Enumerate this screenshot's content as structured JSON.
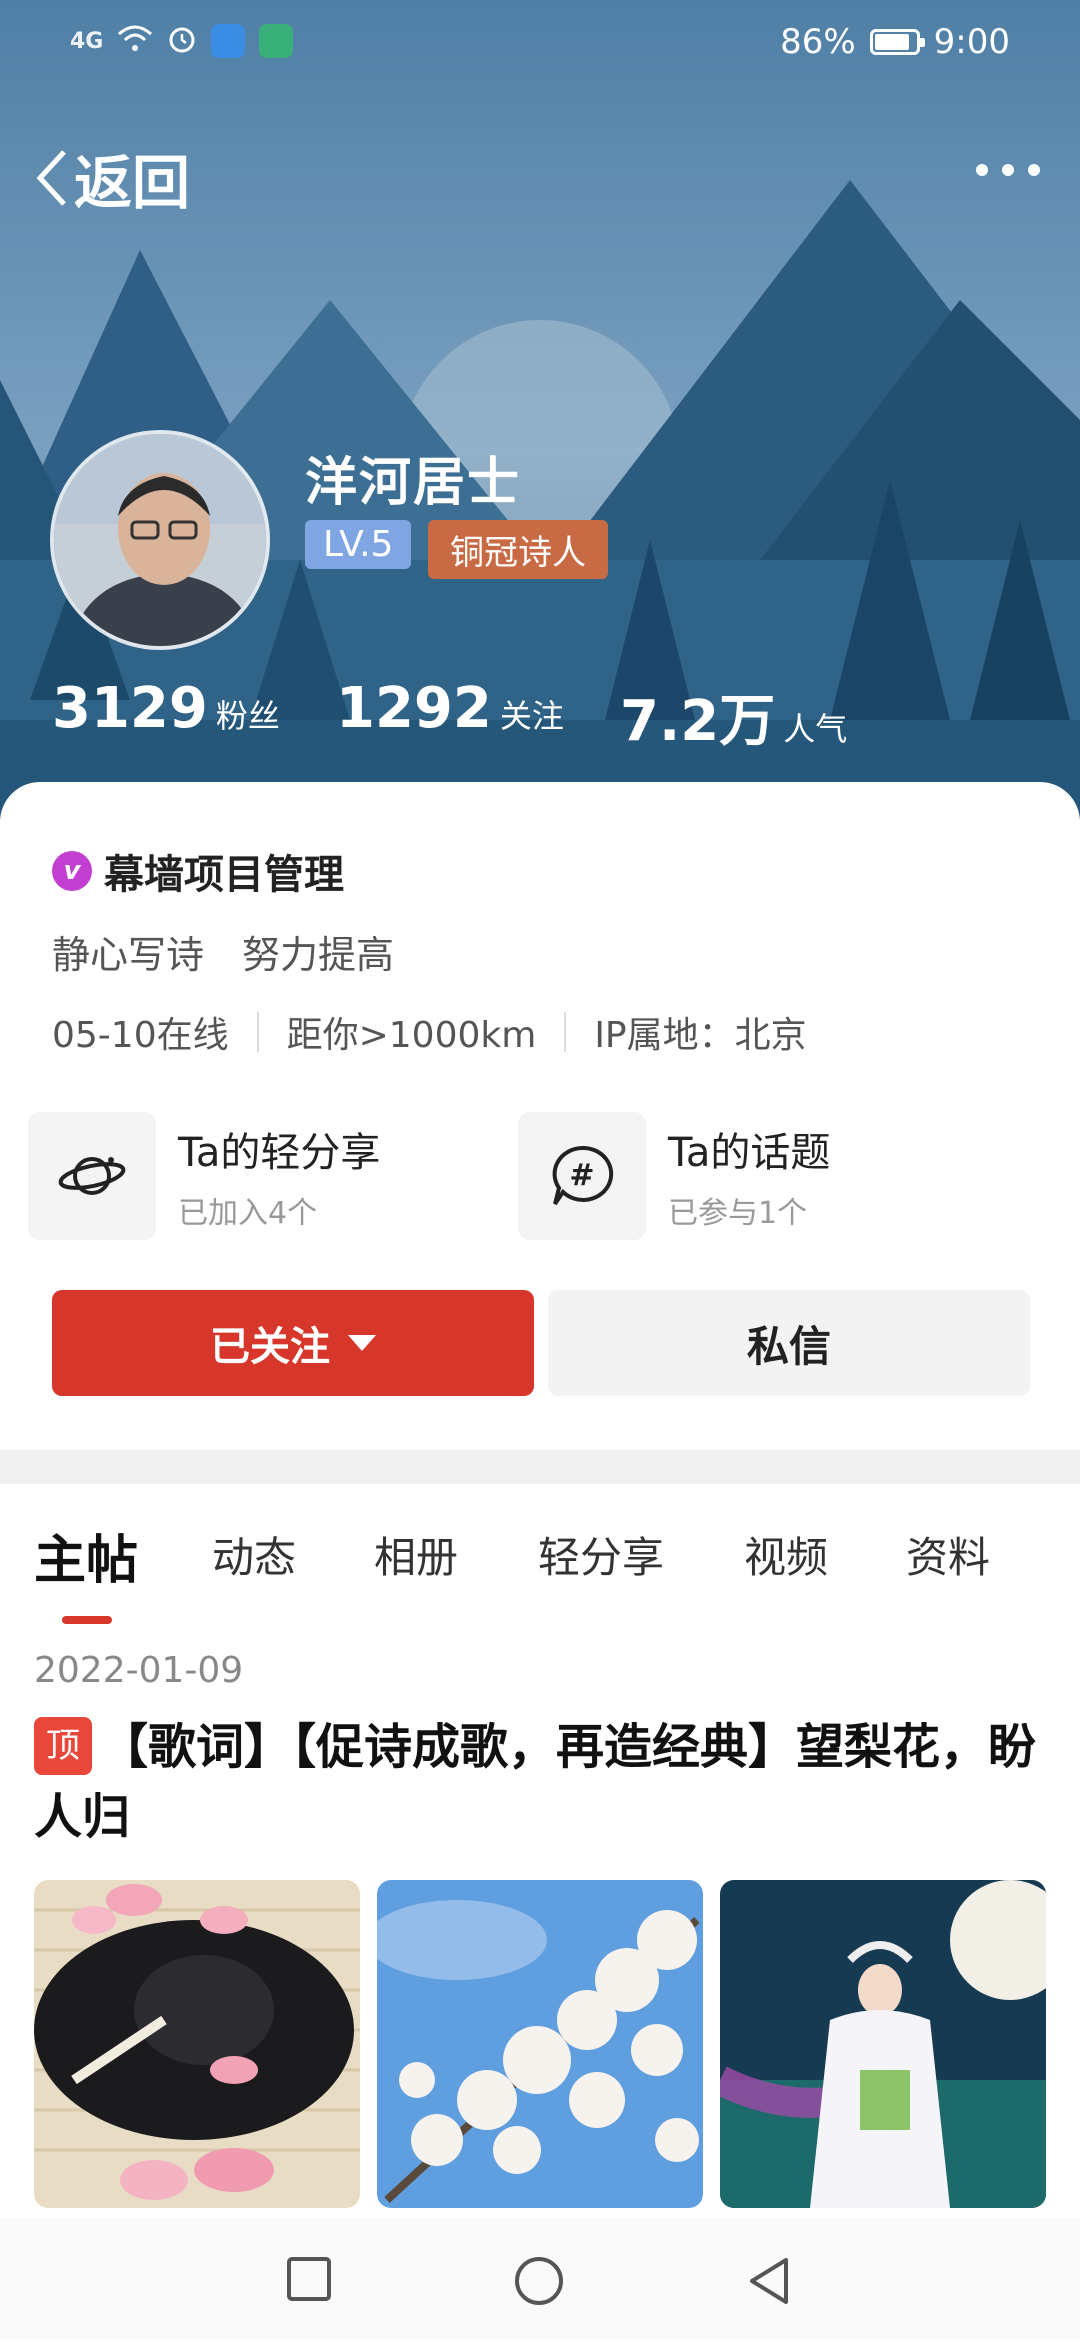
{
  "status_bar": {
    "network": "4G",
    "battery": "86%",
    "battery_level": 0.86,
    "time": "9:00"
  },
  "nav": {
    "back_label": "返回",
    "more_icon": "more-icon"
  },
  "profile": {
    "name": "洋河居士",
    "level": "LV.5",
    "title_badge": "铜冠诗人",
    "stats": [
      {
        "value": "3129",
        "label": "粉丝"
      },
      {
        "value": "1292",
        "label": "关注"
      },
      {
        "value": "7.2万",
        "label": "人气"
      }
    ],
    "verified_label": "幕墙项目管理",
    "bio": "静心写诗　努力提高",
    "online": "05-10在线",
    "distance": "距你>1000km",
    "ip_location": "IP属地：北京"
  },
  "features": [
    {
      "title": "Ta的轻分享",
      "subtitle": "已加入4个",
      "icon": "planet-icon"
    },
    {
      "title": "Ta的话题",
      "subtitle": "已参与1个",
      "icon": "hashtag-chat-icon"
    }
  ],
  "actions": {
    "follow_label": "已关注",
    "message_label": "私信"
  },
  "tabs": [
    "主帖",
    "动态",
    "相册",
    "轻分享",
    "视频",
    "资料"
  ],
  "active_tab": "主帖",
  "post": {
    "date": "2022-01-09",
    "tag": "顶",
    "title": "【歌词】【促诗成歌，再造经典】望梨花，盼人归"
  },
  "colors": {
    "accent_red": "#d7372a",
    "level_blue": "#7fa6e3",
    "badge_orange": "#c86a44",
    "verify_purple": "#c33fd1"
  }
}
